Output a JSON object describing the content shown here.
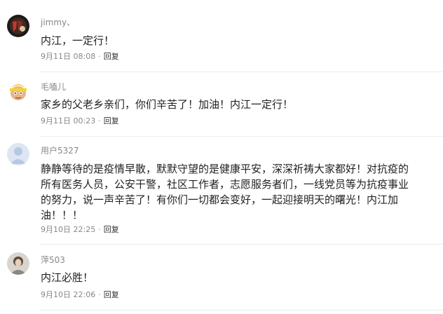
{
  "comments": [
    {
      "username": "jimmy、",
      "text_lines": [
        "内江，一定行！"
      ],
      "timestamp": "9月11日 08:08",
      "separator": "·",
      "reply_label": "回复",
      "avatar": "dark-photo-avatar"
    },
    {
      "username": "毛嗑儿",
      "text_lines": [
        "家乡的父老乡亲们，你们辛苦了！加油！内江一定行！"
      ],
      "timestamp": "9月11日 00:23",
      "separator": "·",
      "reply_label": "回复",
      "avatar": "cartoon-avatar"
    },
    {
      "username": "用户5327",
      "text_lines": [
        "静静等待的是疫情早散，默默守望的是健康平安，深深祈祷大家都好！对抗疫的",
        "所有医务人员，公安干警，社区工作者，志愿服务者们，一线党员等为抗疫事业",
        "的努力，说一声辛苦了！有你们一切都会变好，一起迎接明天的曙光！内江加",
        "油！！！"
      ],
      "timestamp": "9月10日 22:25",
      "separator": "·",
      "reply_label": "回复",
      "avatar": "default-user-avatar"
    },
    {
      "username": "萍503",
      "text_lines": [
        "内江必胜！"
      ],
      "timestamp": "9月10日 22:06",
      "separator": "·",
      "reply_label": "回复",
      "avatar": "photo-avatar"
    }
  ]
}
